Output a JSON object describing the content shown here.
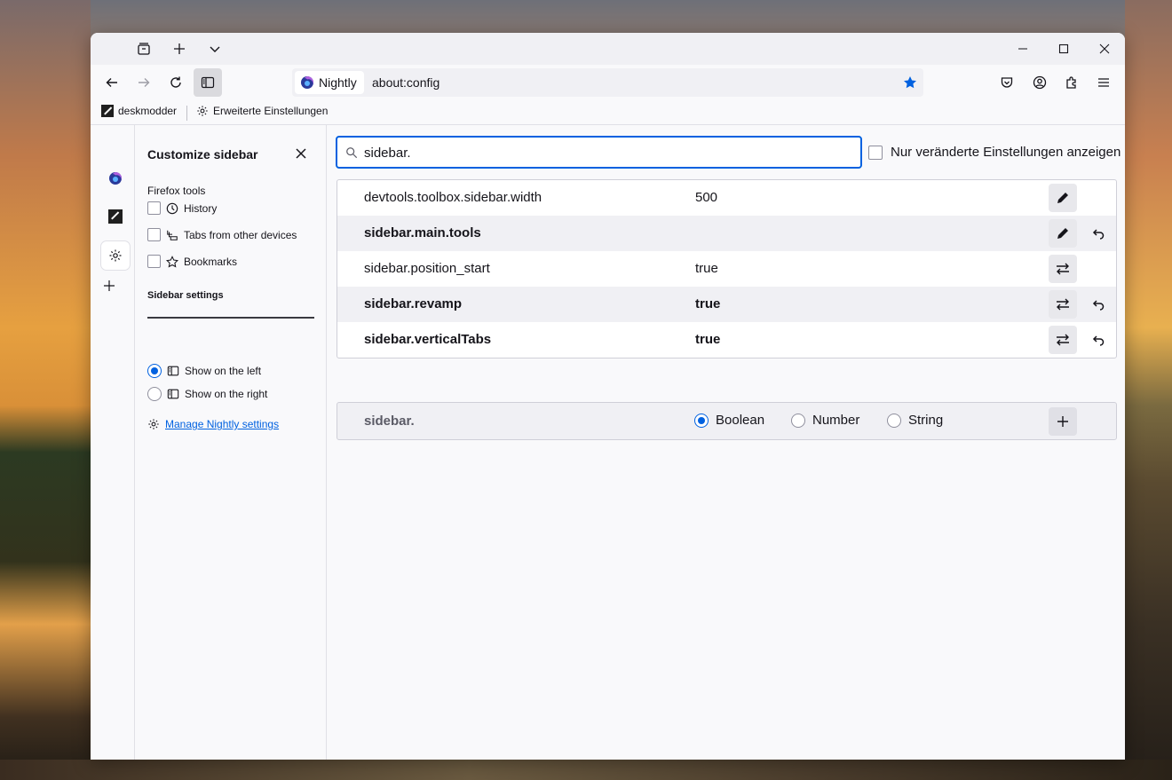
{
  "window": {
    "tab_icons": [
      "tab-overview-icon",
      "new-tab-icon",
      "tab-list-chevron-icon"
    ],
    "controls": [
      "minimize-icon",
      "maximize-icon",
      "close-icon"
    ]
  },
  "navbar": {
    "identity_label": "Nightly",
    "url": "about:config",
    "bookmark_star_color": "#0061e0"
  },
  "bookmarks": {
    "items": [
      {
        "label": "deskmodder",
        "icon": "deskmodder-icon"
      },
      {
        "label": "Erweiterte Einstellungen",
        "icon": "gear-icon"
      }
    ]
  },
  "customize": {
    "title": "Customize sidebar",
    "tools_heading": "Firefox tools",
    "tools": [
      {
        "label": "History",
        "icon": "history-icon",
        "checked": false
      },
      {
        "label": "Tabs from other devices",
        "icon": "synced-tabs-icon",
        "checked": false
      },
      {
        "label": "Bookmarks",
        "icon": "star-icon",
        "checked": false
      }
    ],
    "settings_heading": "Sidebar settings",
    "positions": [
      {
        "label": "Show on the left",
        "selected": true
      },
      {
        "label": "Show on the right",
        "selected": false
      }
    ],
    "manage_link": "Manage Nightly settings"
  },
  "config": {
    "search_value": "sidebar.",
    "modified_only_label": "Nur veränderte Einstellungen anzeigen",
    "prefs": [
      {
        "name": "devtools.toolbox.sidebar.width",
        "value": "500",
        "modified": false,
        "action": "edit"
      },
      {
        "name": "sidebar.main.tools",
        "value": "",
        "modified": true,
        "action": "edit"
      },
      {
        "name": "sidebar.position_start",
        "value": "true",
        "modified": false,
        "action": "toggle"
      },
      {
        "name": "sidebar.revamp",
        "value": "true",
        "modified": true,
        "action": "toggle"
      },
      {
        "name": "sidebar.verticalTabs",
        "value": "true",
        "modified": true,
        "action": "toggle"
      }
    ],
    "new_pref": {
      "name": "sidebar.",
      "types": [
        {
          "label": "Boolean",
          "selected": true
        },
        {
          "label": "Number",
          "selected": false
        },
        {
          "label": "String",
          "selected": false
        }
      ]
    }
  }
}
